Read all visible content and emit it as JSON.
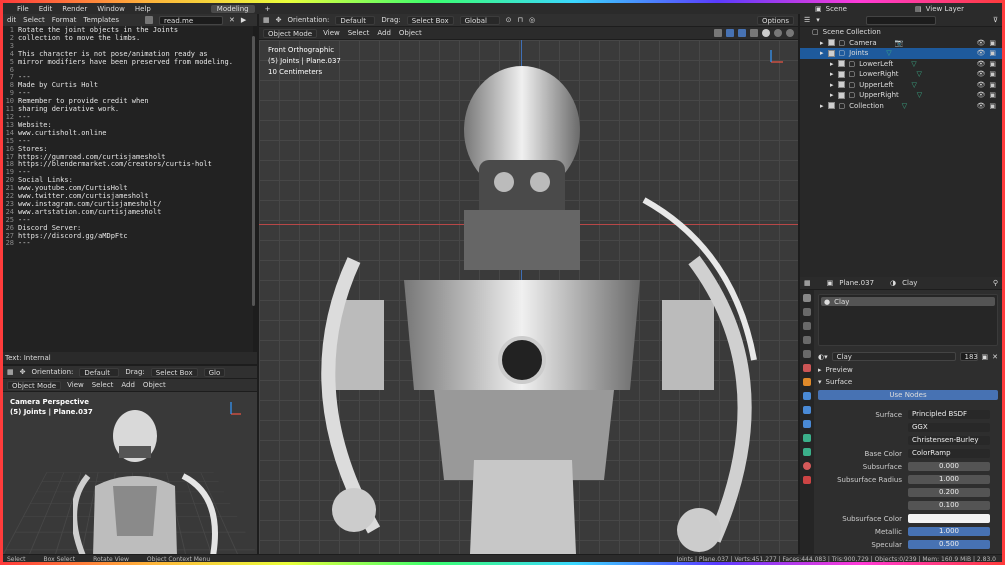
{
  "topbar": {
    "menus": [
      "File",
      "Edit",
      "Render",
      "Window",
      "Help"
    ],
    "workspace_tab": "Modeling",
    "add_tab": "+",
    "scene": "Scene",
    "view_layer": "View Layer"
  },
  "text_editor": {
    "menus": [
      "dit",
      "Select",
      "Format",
      "Templates"
    ],
    "filename": "read.me",
    "footer": "Text: Internal",
    "lines": [
      "Rotate the joint objects in the Joints",
      "collection to move the limbs.",
      "",
      "This character is not pose/animation ready as",
      "mirror modifiers have been preserved from modeling.",
      "",
      "---",
      "Made by Curtis Holt",
      "---",
      "Remember to provide credit when",
      "sharing derivative work.",
      "---",
      "Website:",
      "www.curtisholt.online",
      "---",
      "Stores:",
      "https://gumroad.com/curtisjamesholt",
      "https://blendermarket.com/creators/curtis-holt",
      "---",
      "Social Links:",
      "www.youtube.com/CurtisHolt",
      "www.twitter.com/curtisjamesholt",
      "www.instagram.com/curtisjamesholt/",
      "www.artstation.com/curtisjamesholt",
      "---",
      "Discord Server:",
      "https://discord.gg/aMDpFtc",
      "---"
    ]
  },
  "viewport": {
    "orientation_label": "Orientation:",
    "orientation": "Default",
    "drag_label": "Drag:",
    "drag": "Select Box",
    "transform": "Global",
    "options": "Options",
    "mode": "Object Mode",
    "menus": [
      "View",
      "Select",
      "Add",
      "Object"
    ],
    "overlay1": "Front Orthographic",
    "overlay2": "(5) Joints | Plane.037",
    "overlay3": "10 Centimeters"
  },
  "camera_view": {
    "orientation_label": "Orientation:",
    "orientation": "Default",
    "drag_label": "Drag:",
    "drag": "Select Box",
    "transform": "Glo",
    "mode": "Object Mode",
    "menus": [
      "View",
      "Select",
      "Add",
      "Object"
    ],
    "overlay1": "Camera Perspective",
    "overlay2": "(5) Joints | Plane.037"
  },
  "outliner": {
    "title": "Scene Collection",
    "items": [
      {
        "label": "Camera",
        "selected": false
      },
      {
        "label": "Joints",
        "selected": true
      },
      {
        "label": "LowerLeft",
        "selected": false
      },
      {
        "label": "LowerRight",
        "selected": false
      },
      {
        "label": "UpperLeft",
        "selected": false
      },
      {
        "label": "UpperRight",
        "selected": false
      },
      {
        "label": "Collection",
        "selected": false
      }
    ]
  },
  "properties": {
    "object": "Plane.037",
    "material": "Clay",
    "slot": "Clay",
    "mat_name": "Clay",
    "users": "183",
    "preview": "Preview",
    "surface_section": "Surface",
    "use_nodes": "Use Nodes",
    "rows": [
      {
        "label": "Surface",
        "value": "Principled BSDF",
        "style": "dark"
      },
      {
        "label": "",
        "value": "GGX",
        "style": "dark"
      },
      {
        "label": "",
        "value": "Christensen-Burley",
        "style": "dark"
      },
      {
        "label": "Base Color",
        "value": "ColorRamp",
        "style": "dark"
      },
      {
        "label": "Subsurface",
        "value": "0.000",
        "style": "grey"
      },
      {
        "label": "Subsurface Radius",
        "value": "1.000",
        "style": "grey"
      },
      {
        "label": "",
        "value": "0.200",
        "style": "grey"
      },
      {
        "label": "",
        "value": "0.100",
        "style": "grey"
      },
      {
        "label": "Subsurface Color",
        "value": "",
        "style": "white"
      },
      {
        "label": "Metallic",
        "value": "1.000",
        "style": "blue"
      },
      {
        "label": "Specular",
        "value": "0.500",
        "style": "blue"
      }
    ]
  },
  "statusbar": {
    "items": [
      "Select",
      "Box Select",
      "Rotate View",
      "Object Context Menu"
    ],
    "stats": "Joints | Plane.037 | Verts:451,277 | Faces:444,083 | Tris:900,729 | Objects:0/239 | Mem: 160.9 MiB | 2.83.0"
  }
}
